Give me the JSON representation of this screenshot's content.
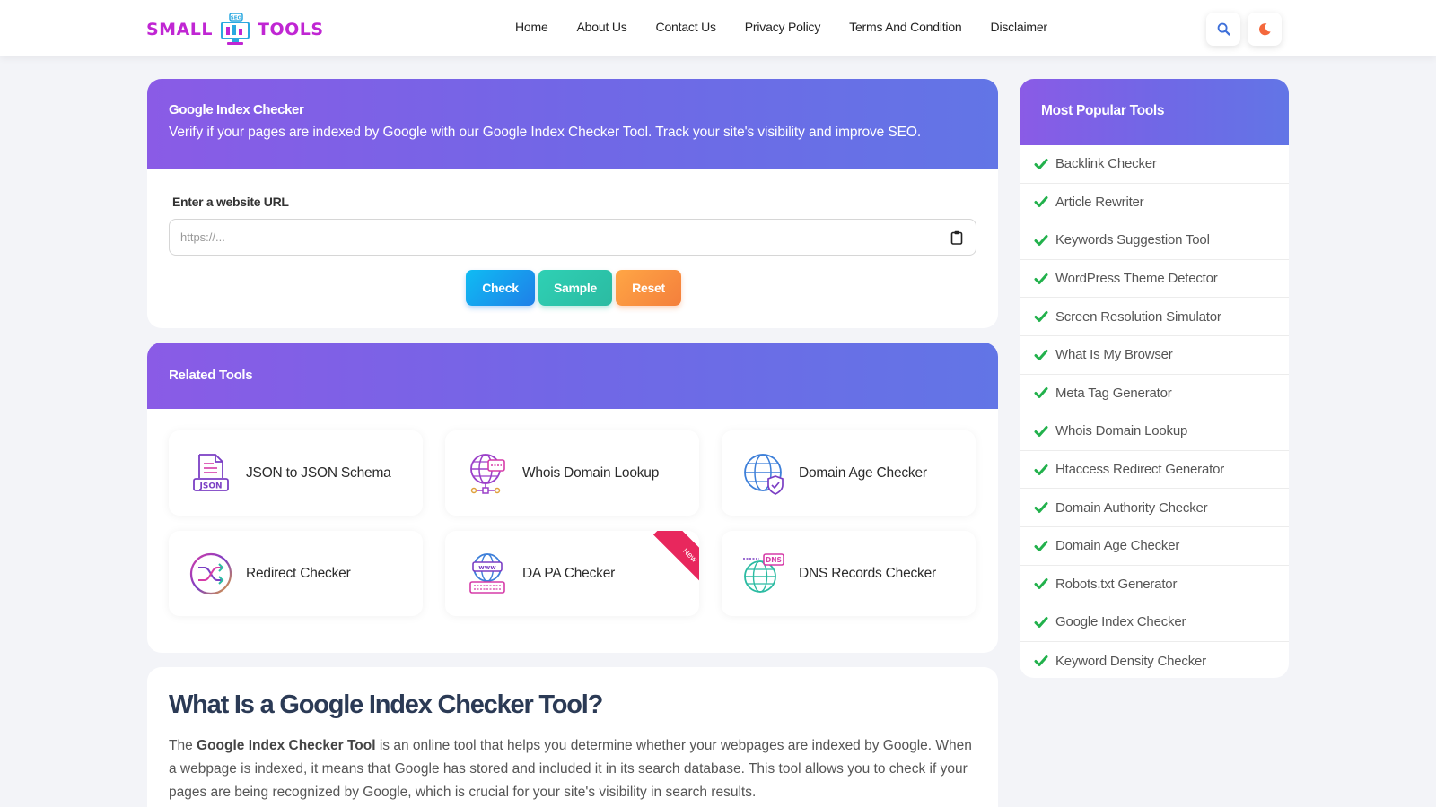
{
  "brand": {
    "left_word": "SMALL",
    "right_word": "TOOLS",
    "badge": "SEO"
  },
  "nav": {
    "items": [
      "Home",
      "About Us",
      "Contact Us",
      "Privacy Policy",
      "Terms And Condition",
      "Disclaimer"
    ],
    "search_icon": "search-icon",
    "theme_icon": "moon-icon"
  },
  "tool": {
    "title": "Google Index Checker",
    "description": "Verify if your pages are indexed by Google with our Google Index Checker Tool. Track your site's visibility and improve SEO.",
    "url_label": "Enter a website URL",
    "url_placeholder": "https://...",
    "url_value": "",
    "buttons": {
      "check": "Check",
      "sample": "Sample",
      "reset": "Reset"
    }
  },
  "related": {
    "title": "Related Tools",
    "tools": [
      {
        "label": "JSON to JSON Schema",
        "icon": "json-file-icon"
      },
      {
        "label": "Whois Domain Lookup",
        "icon": "globe-network-icon"
      },
      {
        "label": "Domain Age Checker",
        "icon": "globe-shield-icon"
      },
      {
        "label": "Redirect Checker",
        "icon": "shuffle-icon"
      },
      {
        "label": "DA PA Checker",
        "icon": "www-globe-icon",
        "badge": "New"
      },
      {
        "label": "DNS Records Checker",
        "icon": "dns-globe-icon"
      }
    ]
  },
  "content": {
    "heading": "What Is a Google Index Checker Tool?",
    "p_prefix": "The ",
    "p_bold": "Google Index Checker Tool",
    "p_rest": " is an online tool that helps you determine whether your webpages are indexed by Google. When a webpage is indexed, it means that Google has stored and included it in its search database. This tool allows you to check if your pages are being recognized by Google, which is crucial for your site's visibility in search results."
  },
  "popular": {
    "title": "Most Popular Tools",
    "items": [
      "Backlink Checker",
      "Article Rewriter",
      "Keywords Suggestion Tool",
      "WordPress Theme Detector",
      "Screen Resolution Simulator",
      "What Is My Browser",
      "Meta Tag Generator",
      "Whois Domain Lookup",
      "Htaccess Redirect Generator",
      "Domain Authority Checker",
      "Domain Age Checker",
      "Robots.txt Generator",
      "Google Index Checker",
      "Keyword Density Checker"
    ]
  },
  "colors": {
    "header_gradient_start": "#8a5be6",
    "header_gradient_end": "#6275e6",
    "check_green": "#22b14c",
    "brand_magenta": "#c026d3",
    "ribbon_red": "#e8275d"
  }
}
